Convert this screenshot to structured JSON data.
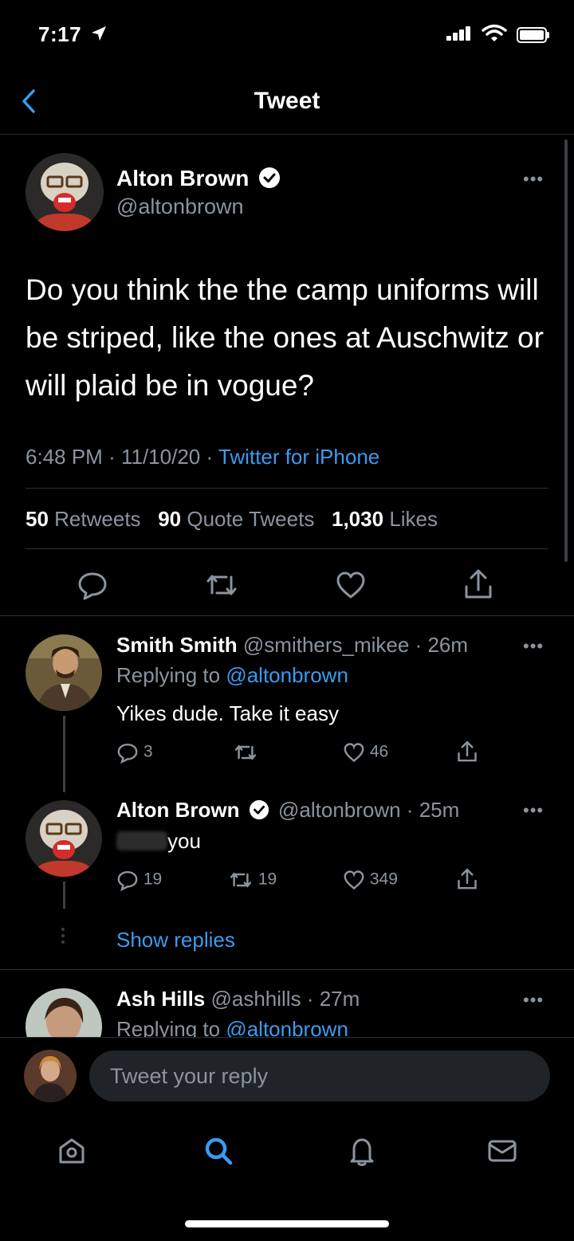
{
  "status_bar": {
    "time": "7:17"
  },
  "header": {
    "title": "Tweet"
  },
  "main_tweet": {
    "author_name": "Alton Brown",
    "author_handle": "@altonbrown",
    "text": "Do you think the the camp uniforms will be striped, like the ones at Auschwitz or will plaid be in vogue?",
    "time": "6:48 PM",
    "date": "11/10/20",
    "source": "Twitter for iPhone",
    "separator": "·",
    "stats": {
      "retweets_count": "50",
      "retweets_label": "Retweets",
      "quotes_count": "90",
      "quotes_label": "Quote Tweets",
      "likes_count": "1,030",
      "likes_label": "Likes"
    }
  },
  "replies": [
    {
      "name": "Smith Smith",
      "handle": "@smithers_mikee · 26m",
      "replying_prefix": "Replying to",
      "replying_to": "@altonbrown",
      "text": "Yikes dude. Take it easy",
      "reply_count": "3",
      "retweet_count": "",
      "like_count": "46"
    },
    {
      "name": "Alton Brown",
      "handle": "@altonbrown · 25m",
      "text": "you",
      "reply_count": "19",
      "retweet_count": "19",
      "like_count": "349",
      "show_replies": "Show replies"
    },
    {
      "name": "Ash Hills",
      "handle": "@ashhills · 27m",
      "replying_prefix": "Replying to",
      "replying_to": "@altonbrown"
    }
  ],
  "compose": {
    "placeholder": "Tweet your reply"
  },
  "colors": {
    "background": "#000000",
    "accent": "#3a9bf0",
    "secondary_text": "#8b949e",
    "verified": "#ffffff"
  },
  "icons": [
    "back-chevron-icon",
    "verified-badge-icon",
    "more-icon",
    "reply-icon",
    "retweet-icon",
    "like-icon",
    "share-icon",
    "home-icon",
    "search-icon",
    "notifications-icon",
    "messages-icon"
  ]
}
